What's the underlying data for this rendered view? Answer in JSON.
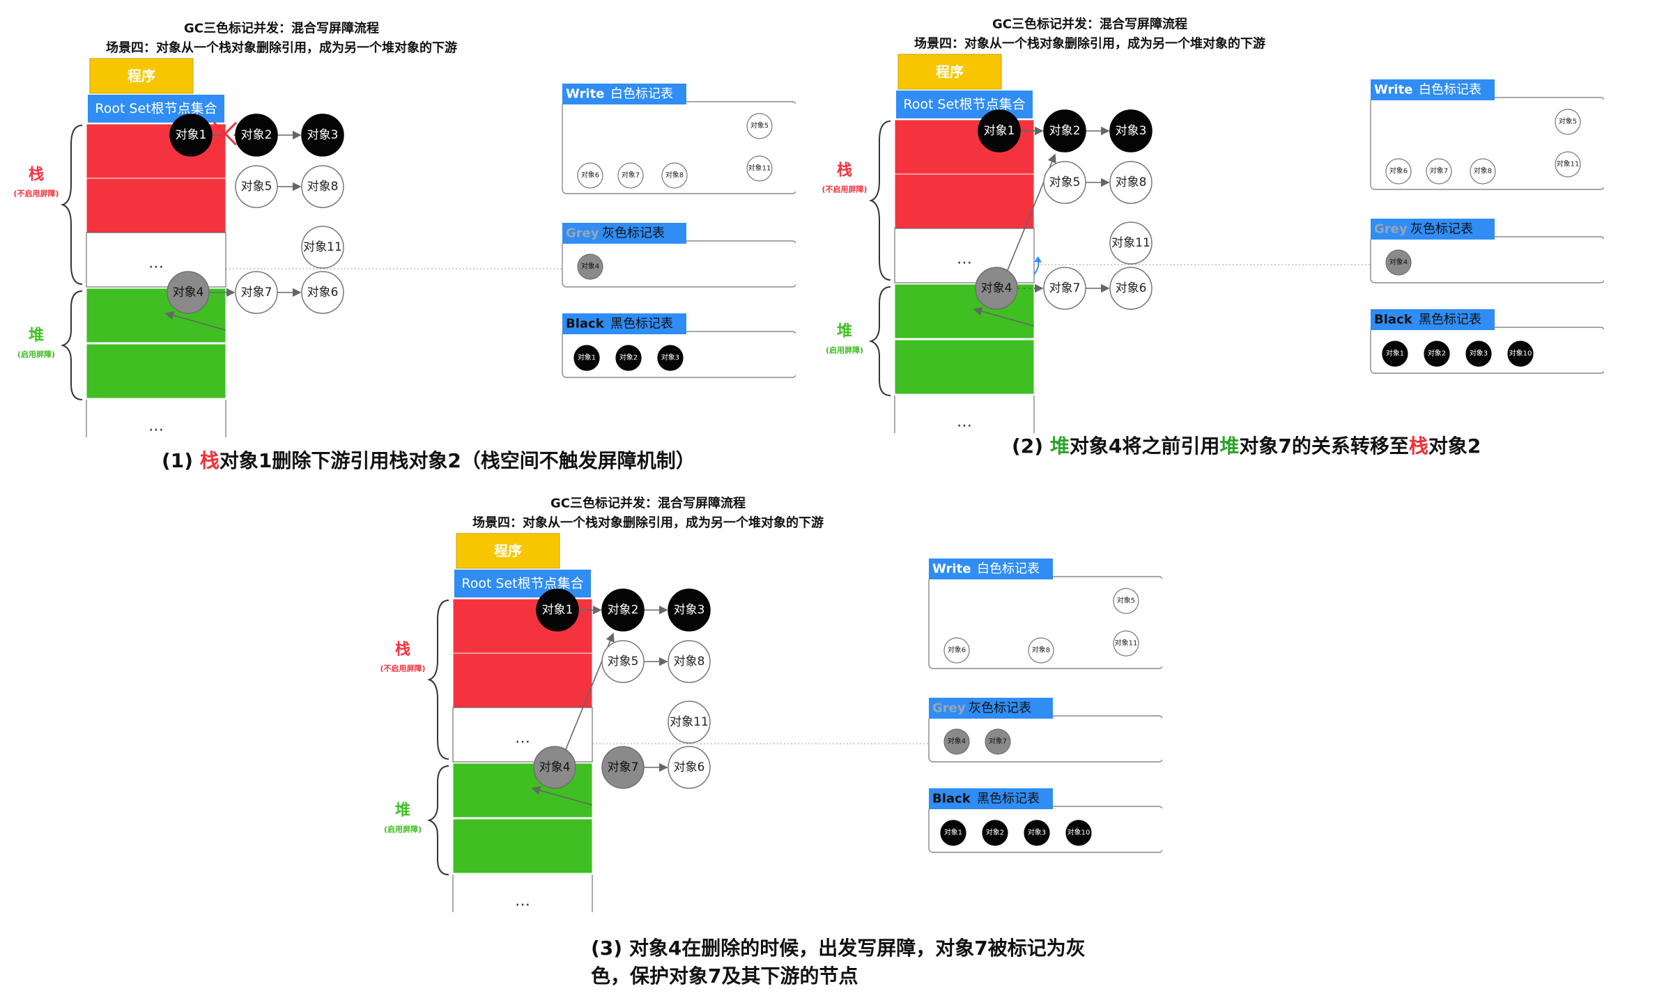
{
  "panels": [
    {
      "title": "GC三色标记并发：混合写屏障流程",
      "subtitle": "场景四：对象从一个栈对象删除引用，成为另一个堆对象的下游",
      "program_label": "程序",
      "root_label": "Root Set根节点集合",
      "stack_label": "栈",
      "stack_sub": "(不启用屏障)",
      "heap_label": "堆",
      "heap_sub": "(启用屏障)",
      "ellipsis": "…",
      "nodes": {
        "obj1": "对象1",
        "obj2": "对象2",
        "obj3": "对象3",
        "obj5": "对象5",
        "obj8": "对象8",
        "obj11": "对象11",
        "obj4": "对象4",
        "obj7": "对象7",
        "obj6": "对象6"
      },
      "white_table": {
        "label_en": "Write",
        "label_cn": "白色标记表",
        "items": [
          "对象6",
          "对象7",
          "对象8",
          "对象5",
          "对象11"
        ]
      },
      "grey_table": {
        "label_en": "Grey",
        "label_cn": "灰色标记表",
        "items": [
          "对象4"
        ]
      },
      "black_table": {
        "label_en": "Black",
        "label_cn": "黑色标记表",
        "items": [
          "对象1",
          "对象2",
          "对象3"
        ]
      }
    },
    {
      "title": "GC三色标记并发：混合写屏障流程",
      "subtitle": "场景四：对象从一个栈对象删除引用，成为另一个堆对象的下游",
      "program_label": "程序",
      "root_label": "Root Set根节点集合",
      "stack_label": "栈",
      "stack_sub": "(不启用屏障)",
      "heap_label": "堆",
      "heap_sub": "(启用屏障)",
      "ellipsis": "…",
      "nodes": {
        "obj1": "对象1",
        "obj2": "对象2",
        "obj3": "对象3",
        "obj5": "对象5",
        "obj8": "对象8",
        "obj11": "对象11",
        "obj4": "对象4",
        "obj7": "对象7",
        "obj6": "对象6"
      },
      "white_table": {
        "label_en": "Write",
        "label_cn": "白色标记表",
        "items": [
          "对象6",
          "对象7",
          "对象8",
          "对象5",
          "对象11"
        ]
      },
      "grey_table": {
        "label_en": "Grey",
        "label_cn": "灰色标记表",
        "items": [
          "对象4"
        ]
      },
      "black_table": {
        "label_en": "Black",
        "label_cn": "黑色标记表",
        "items": [
          "对象1",
          "对象2",
          "对象3",
          "对象10"
        ]
      }
    },
    {
      "title": "GC三色标记并发：混合写屏障流程",
      "subtitle": "场景四：对象从一个栈对象删除引用，成为另一个堆对象的下游",
      "program_label": "程序",
      "root_label": "Root Set根节点集合",
      "stack_label": "栈",
      "stack_sub": "(不启用屏障)",
      "heap_label": "堆",
      "heap_sub": "(启用屏障)",
      "ellipsis": "…",
      "nodes": {
        "obj1": "对象1",
        "obj2": "对象2",
        "obj3": "对象3",
        "obj5": "对象5",
        "obj8": "对象8",
        "obj11": "对象11",
        "obj4": "对象4",
        "obj7": "对象7",
        "obj6": "对象6"
      },
      "white_table": {
        "label_en": "Write",
        "label_cn": "白色标记表",
        "items": [
          "对象6",
          "对象8",
          "对象5",
          "对象11"
        ]
      },
      "grey_table": {
        "label_en": "Grey",
        "label_cn": "灰色标记表",
        "items": [
          "对象4",
          "对象7"
        ]
      },
      "black_table": {
        "label_en": "Black",
        "label_cn": "黑色标记表",
        "items": [
          "对象1",
          "对象2",
          "对象3",
          "对象10"
        ]
      }
    }
  ],
  "captions": {
    "c1": {
      "prefix": "(1) ",
      "hl": "栈",
      "rest": "对象1删除下游引用栈对象2（栈空间不触发屏障机制）"
    },
    "c2": {
      "prefix": "(2) ",
      "hl1": "堆",
      "mid1": "对象4将之前引用",
      "hl2": "堆",
      "mid2": "对象7的关系转移至",
      "hl3": "栈",
      "rest": "对象2"
    },
    "c3": {
      "line1": "(3) 对象4在删除的时候，出发写屏障，对象7被标记为灰",
      "line2": "色，保护对象7及其下游的节点"
    }
  },
  "colors": {
    "program": "#f7c600",
    "root": "#2f8df5",
    "stack": "#f5333f",
    "heap": "#3fbf22",
    "black_node": "#050505",
    "grey_node": "#8a8a8a",
    "grey_text": "#9aa6b2",
    "delete_x": "#f0303a",
    "hint_arrow": "#2f8df5"
  }
}
